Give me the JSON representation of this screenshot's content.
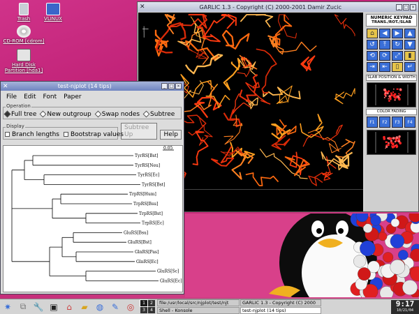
{
  "desktop": {
    "icons": [
      {
        "label": "Trash"
      },
      {
        "label": "VLINUX"
      },
      {
        "label": "CD-ROM [cdrom]"
      },
      {
        "label": "Hard Disk Partition [hda1]"
      }
    ]
  },
  "garlic": {
    "title": "GARLIC 1.3 - Copyright (C) 2000-2001 Damir Zucic",
    "keypad_title": "NUMERIC KEYPAD",
    "keypad_subtitle": "TRANS./ROT./SLAB",
    "slab_title": "SLAB POSITION & WIDTH",
    "fading_title": "COLOR FADING",
    "fading_buttons": [
      "F1",
      "F2",
      "F3",
      "F4"
    ]
  },
  "njplot": {
    "title": "test-njplot (14 tips)",
    "menu": [
      "File",
      "Edit",
      "Font",
      "Paper"
    ],
    "operation_label": "Operation",
    "operations": [
      "Full tree",
      "New outgroup",
      "Swap nodes",
      "Subtree"
    ],
    "display_label": "Display",
    "display_options": [
      "Branch lengths",
      "Bootstrap values"
    ],
    "subtree_up": "Subtree Up",
    "help": "Help",
    "scale": "0.05",
    "leaves": [
      "TyrRS[Bst]",
      "TyrRS[Neu]",
      "TyrRS[Ec]",
      "TyrRS[Bst]",
      "TrpRS[Hum]",
      "TrpRS[Bsu]",
      "TrpRS[Bst]",
      "TrpRS[Ec]",
      "GluRS[Bsu]",
      "GluRS[Bst]",
      "GlnRS[Pas]",
      "GlnRS[Ec]",
      "GluRS[Sc]",
      "GluRS[Ec]"
    ]
  },
  "taskbar": {
    "pager": [
      "1",
      "2",
      "3",
      "4"
    ],
    "tasks": [
      "file:/usr/local/src/njplot/test/njt",
      "GARLIC 1.3 - Copyright (C) 2000",
      "Shell - Konsole",
      "test-njplot (14 tips)"
    ],
    "time": "9:17",
    "date": "10/21/04"
  }
}
